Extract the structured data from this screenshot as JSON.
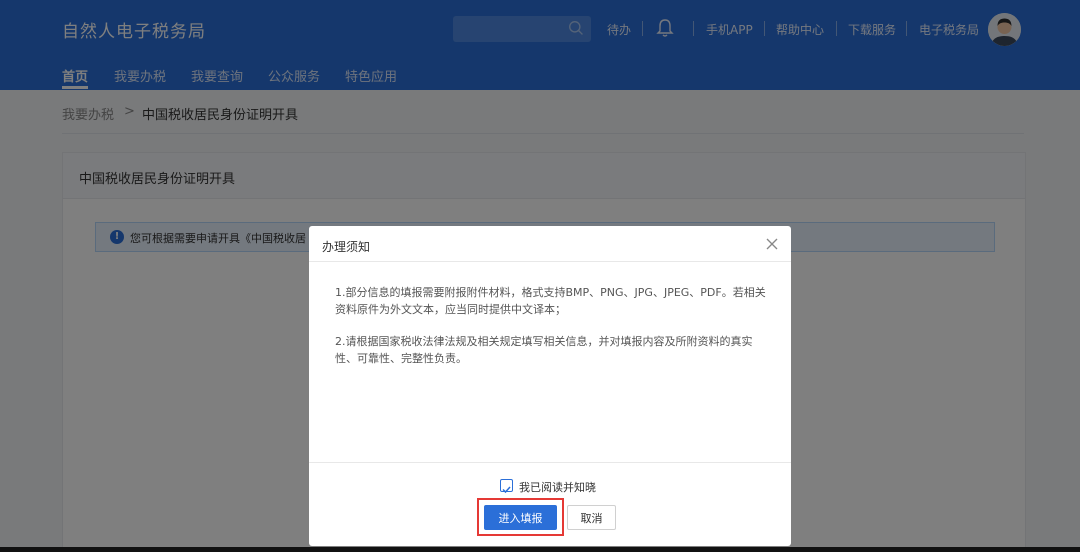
{
  "app": {
    "title": "自然人电子税务局"
  },
  "search": {
    "placeholder": ""
  },
  "header": {
    "links": {
      "todo": "待办",
      "mobile_app": "手机APP",
      "help": "帮助中心",
      "download": "下载服务",
      "etax": "电子税务局"
    }
  },
  "nav": {
    "items": [
      {
        "label": "首页",
        "active": true
      },
      {
        "label": "我要办税"
      },
      {
        "label": "我要查询"
      },
      {
        "label": "公众服务"
      },
      {
        "label": "特色应用"
      }
    ]
  },
  "breadcrumb": {
    "parent": "我要办税",
    "separator": ">",
    "current": "中国税收居民身份证明开具"
  },
  "panel": {
    "title": "中国税收居民身份证明开具",
    "notice": "您可根据需要申请开具《中国税收居"
  },
  "modal": {
    "title": "办理须知",
    "paragraphs": [
      "1.部分信息的填报需要附报附件材料，格式支持BMP、PNG、JPG、JPEG、PDF。若相关资料原件为外文文本，应当同时提供中文译本；",
      "2.请根据国家税收法律法规及相关规定填写相关信息，并对填报内容及所附资料的真实性、可靠性、完整性负责。"
    ],
    "agree_label": "我已阅读并知晓",
    "agree_checked": true,
    "confirm_label": "进入填报",
    "cancel_label": "取消"
  },
  "colors": {
    "brand": "#2b6fd8",
    "highlight": "#e53935"
  },
  "icons": [
    "search-icon",
    "bell-icon",
    "avatar",
    "info-icon",
    "close-icon",
    "check-icon"
  ]
}
